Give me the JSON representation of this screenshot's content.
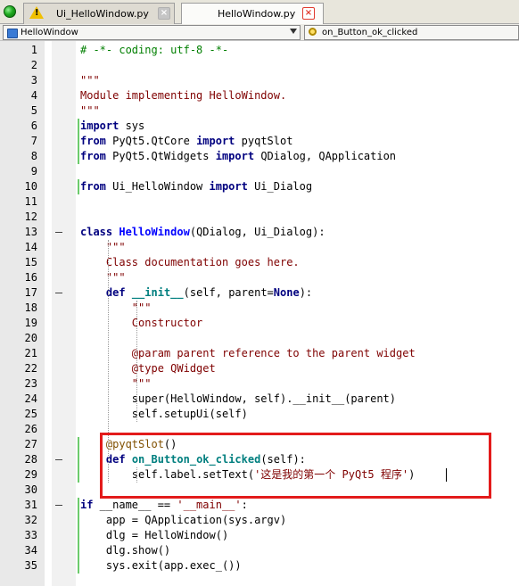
{
  "tabs": [
    {
      "label": "Ui_HelloWindow.py",
      "close": "×",
      "active": false,
      "icon": "warning-icon"
    },
    {
      "label": "HelloWindow.py",
      "close": "×",
      "active": true
    }
  ],
  "selectors": {
    "class_value": "HelloWindow",
    "method_value": "on_Button_ok_clicked"
  },
  "colors": {
    "highlight_box": "#e31b1b",
    "change_bar": "#6ccb6c"
  },
  "line_numbers": [
    "1",
    "2",
    "3",
    "4",
    "5",
    "6",
    "7",
    "8",
    "9",
    "10",
    "11",
    "12",
    "13",
    "14",
    "15",
    "16",
    "17",
    "18",
    "19",
    "20",
    "21",
    "22",
    "23",
    "24",
    "25",
    "26",
    "27",
    "28",
    "29",
    "30",
    "31",
    "32",
    "33",
    "34",
    "35"
  ],
  "code_lines": [
    [
      {
        "t": "# -*- coding: utf-8 -*-",
        "c": "cm"
      }
    ],
    [],
    [
      {
        "t": "\"\"\"",
        "c": "st"
      }
    ],
    [
      {
        "t": "Module implementing HelloWindow.",
        "c": "st"
      }
    ],
    [
      {
        "t": "\"\"\"",
        "c": "st"
      }
    ],
    [
      {
        "t": "import",
        "c": "kw"
      },
      {
        "t": " sys",
        "c": ""
      }
    ],
    [
      {
        "t": "from",
        "c": "kw"
      },
      {
        "t": " PyQt5.QtCore ",
        "c": ""
      },
      {
        "t": "import",
        "c": "kw"
      },
      {
        "t": " pyqtSlot",
        "c": ""
      }
    ],
    [
      {
        "t": "from",
        "c": "kw"
      },
      {
        "t": " PyQt5.QtWidgets ",
        "c": ""
      },
      {
        "t": "import",
        "c": "kw"
      },
      {
        "t": " QDialog, QApplication",
        "c": ""
      }
    ],
    [],
    [
      {
        "t": "from",
        "c": "kw"
      },
      {
        "t": " Ui_HelloWindow ",
        "c": ""
      },
      {
        "t": "import",
        "c": "kw"
      },
      {
        "t": " Ui_Dialog",
        "c": ""
      }
    ],
    [],
    [],
    [
      {
        "t": "class",
        "c": "kw"
      },
      {
        "t": " ",
        "c": ""
      },
      {
        "t": "HelloWindow",
        "c": "cn"
      },
      {
        "t": "(QDialog, Ui_Dialog):",
        "c": ""
      }
    ],
    [
      {
        "t": "    \"\"\"",
        "c": "st"
      }
    ],
    [
      {
        "t": "    Class documentation goes here.",
        "c": "st"
      }
    ],
    [
      {
        "t": "    \"\"\"",
        "c": "st"
      }
    ],
    [
      {
        "t": "    ",
        "c": ""
      },
      {
        "t": "def",
        "c": "kw"
      },
      {
        "t": " ",
        "c": ""
      },
      {
        "t": "__init__",
        "c": "dn"
      },
      {
        "t": "(self, parent=",
        "c": ""
      },
      {
        "t": "None",
        "c": "kw"
      },
      {
        "t": "):",
        "c": ""
      }
    ],
    [
      {
        "t": "        \"\"\"",
        "c": "st"
      }
    ],
    [
      {
        "t": "        Constructor",
        "c": "st"
      }
    ],
    [],
    [
      {
        "t": "        @param parent reference to the parent widget",
        "c": "st"
      }
    ],
    [
      {
        "t": "        @type QWidget",
        "c": "st"
      }
    ],
    [
      {
        "t": "        \"\"\"",
        "c": "st"
      }
    ],
    [
      {
        "t": "        super(HelloWindow, self).__init__(parent)",
        "c": ""
      }
    ],
    [
      {
        "t": "        self.setupUi(self)",
        "c": ""
      }
    ],
    [],
    [
      {
        "t": "    @pyqtSlot",
        "c": "dec"
      },
      {
        "t": "()",
        "c": ""
      }
    ],
    [
      {
        "t": "    ",
        "c": ""
      },
      {
        "t": "def",
        "c": "kw"
      },
      {
        "t": " ",
        "c": ""
      },
      {
        "t": "on_Button_ok_clicked",
        "c": "dn"
      },
      {
        "t": "(self):",
        "c": ""
      }
    ],
    [
      {
        "t": "        self.label.setText(",
        "c": ""
      },
      {
        "t": "'这是我的第一个 PyQt5 程序'",
        "c": "st"
      },
      {
        "t": ")",
        "c": ""
      }
    ],
    [],
    [
      {
        "t": "if",
        "c": "kw"
      },
      {
        "t": " __name__ == ",
        "c": ""
      },
      {
        "t": "'__main__'",
        "c": "st"
      },
      {
        "t": ":",
        "c": ""
      }
    ],
    [
      {
        "t": "    app = QApplication(sys.argv)",
        "c": ""
      }
    ],
    [
      {
        "t": "    dlg = HelloWindow()",
        "c": ""
      }
    ],
    [
      {
        "t": "    dlg.show()",
        "c": ""
      }
    ],
    [
      {
        "t": "    sys.exit(app.exec_())",
        "c": ""
      }
    ]
  ]
}
